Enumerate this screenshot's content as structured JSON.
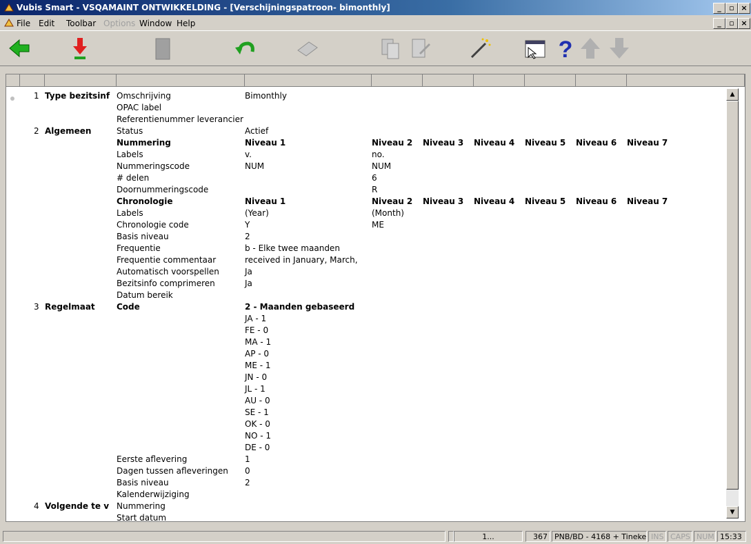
{
  "window": {
    "title": "Vubis Smart - VSQAMAINT ONTWIKKELDING - [Verschijningspatroon- bimonthly]"
  },
  "menu": [
    {
      "label": "File",
      "enabled": true
    },
    {
      "label": "Edit",
      "enabled": true
    },
    {
      "label": "Toolbar",
      "enabled": true
    },
    {
      "label": "Options",
      "enabled": false
    },
    {
      "label": "Window",
      "enabled": true
    },
    {
      "label": "Help",
      "enabled": true
    }
  ],
  "toolbar_icons": [
    "back-arrow-icon",
    "download-arrow-icon",
    "trash-icon",
    "undo-icon",
    "book-icon",
    "copy-icon",
    "edit-document-icon",
    "magic-wand-icon",
    "window-cursor-icon",
    "help-icon",
    "up-arrow-icon",
    "down-arrow-icon"
  ],
  "sections": [
    {
      "num": "1",
      "name": "Type bezitsinf",
      "lines": [
        {
          "label": "Omschrijving",
          "value": "Bimonthly"
        },
        {
          "label": "OPAC label"
        },
        {
          "label": "Referentienummer leverancier"
        }
      ]
    },
    {
      "num": "2",
      "name": "Algemeen",
      "lines": [
        {
          "label": "Status",
          "value": "Actief"
        },
        {
          "label": "Nummering",
          "bold": true,
          "value": "Niveau 1",
          "levels": [
            "Niveau 2",
            "Niveau 3",
            "Niveau 4",
            "Niveau 5",
            "Niveau 6",
            "Niveau 7"
          ]
        },
        {
          "label": "Labels",
          "value": "v.",
          "l2": "no."
        },
        {
          "label": "Nummeringscode",
          "value": "NUM",
          "l2": "NUM"
        },
        {
          "label": "# delen",
          "l2": "6"
        },
        {
          "label": "Doornummeringscode",
          "l2": "R"
        },
        {
          "label": "Chronologie",
          "bold": true,
          "value": "Niveau 1",
          "levels": [
            "Niveau 2",
            "Niveau 3",
            "Niveau 4",
            "Niveau 5",
            "Niveau 6",
            "Niveau 7"
          ]
        },
        {
          "label": "Labels",
          "value": "(Year)",
          "l2": "(Month)"
        },
        {
          "label": "Chronologie code",
          "value": "Y",
          "l2": "ME"
        },
        {
          "label": "Basis niveau",
          "value": "2"
        },
        {
          "label": "Frequentie",
          "value": "b - Elke twee maanden"
        },
        {
          "label": "Frequentie commentaar",
          "value": "received in January, March,"
        },
        {
          "label": "Automatisch voorspellen",
          "value": "Ja"
        },
        {
          "label": "Bezitsinfo comprimeren",
          "value": "Ja"
        },
        {
          "label": "Datum bereik"
        }
      ]
    },
    {
      "num": "3",
      "name": "Regelmaat",
      "lines": [
        {
          "label": "Code",
          "bold": true,
          "value": "2 - Maanden gebaseerd",
          "valueBold": true
        },
        {
          "value": "JA - 1"
        },
        {
          "value": "FE - 0"
        },
        {
          "value": "MA - 1"
        },
        {
          "value": "AP - 0"
        },
        {
          "value": "ME - 1"
        },
        {
          "value": "JN - 0"
        },
        {
          "value": "JL - 1"
        },
        {
          "value": "AU - 0"
        },
        {
          "value": "SE - 1"
        },
        {
          "value": "OK - 0"
        },
        {
          "value": "NO - 1"
        },
        {
          "value": "DE - 0"
        },
        {
          "label": "Eerste aflevering",
          "value": "1"
        },
        {
          "label": "Dagen tussen afleveringen",
          "value": "0"
        },
        {
          "label": "Basis niveau",
          "value": "2"
        },
        {
          "label": "Kalenderwijziging"
        }
      ]
    },
    {
      "num": "4",
      "name": "Volgende te v",
      "lines": [
        {
          "label": "Nummering"
        },
        {
          "label": "Start datum"
        }
      ]
    }
  ],
  "status": [
    "",
    "1...",
    "367",
    "PNB/BD - 4168 + Tineke",
    "INS",
    "CAPS",
    "NUM",
    "15:33"
  ]
}
